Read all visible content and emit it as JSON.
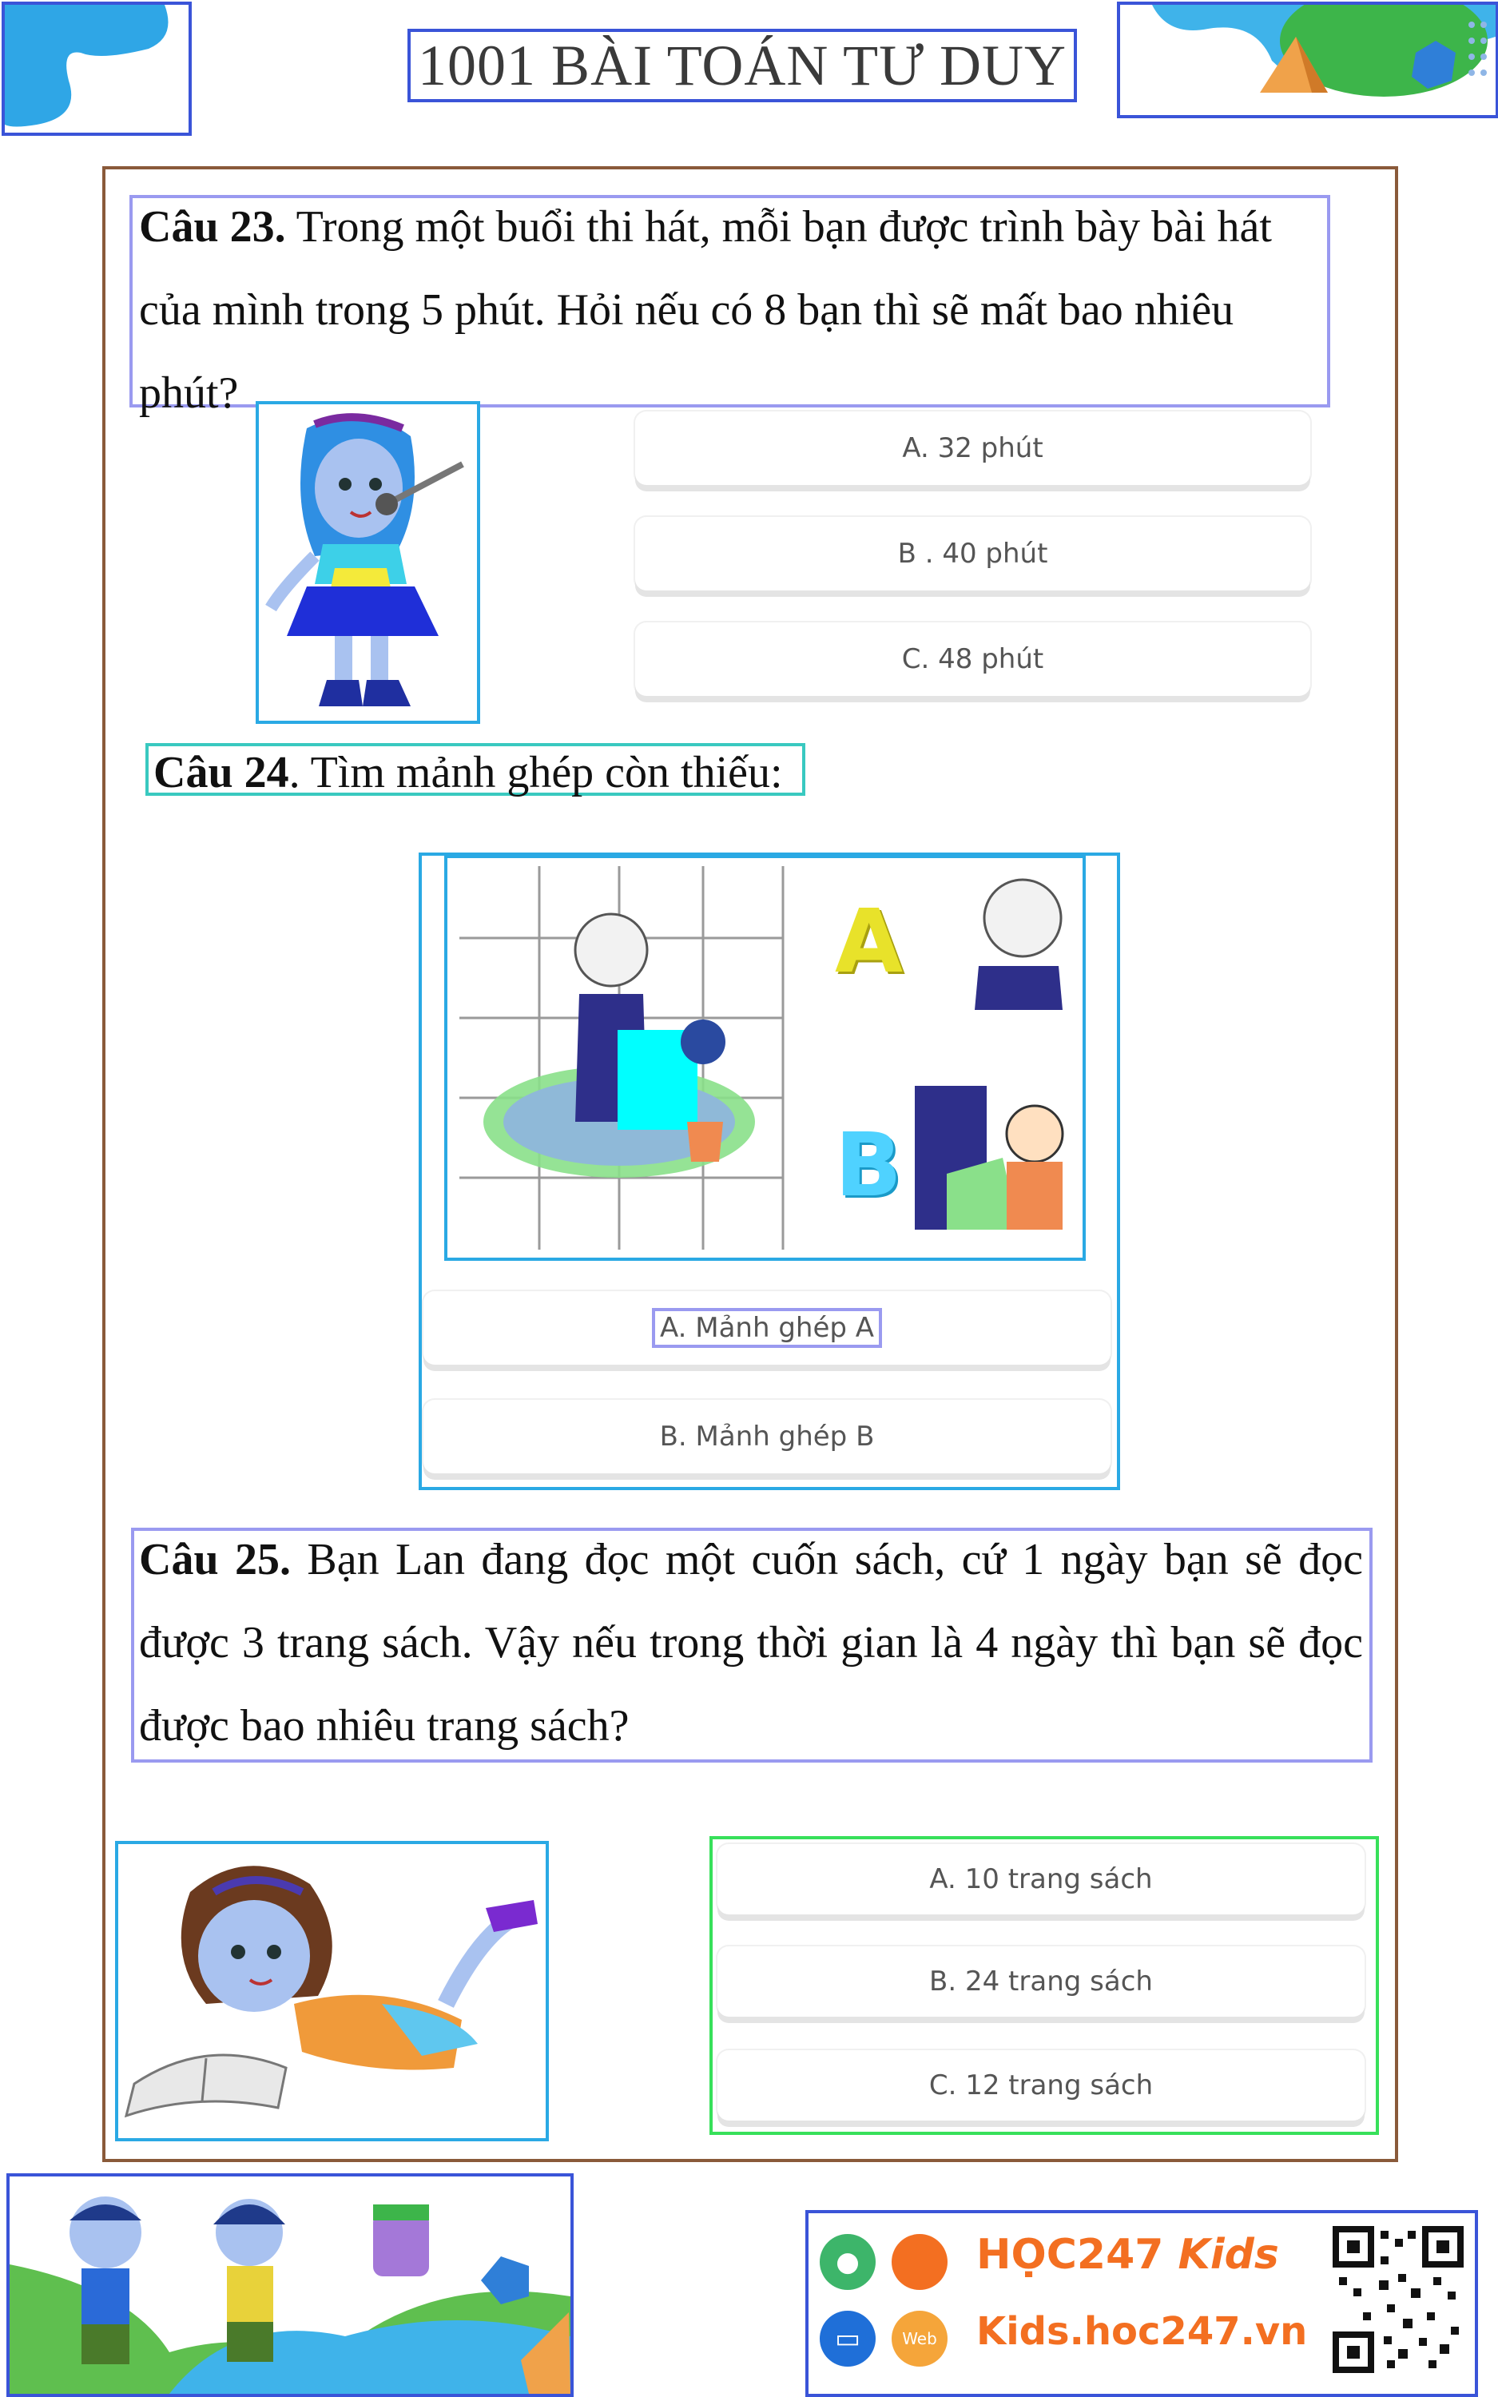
{
  "header": {
    "title": "1001 BÀI TOÁN TƯ DUY"
  },
  "q23": {
    "label": "Câu 23.",
    "text": " Trong một buổi thi hát, mỗi bạn được trình bày bài hát của mình trong 5 phút. Hỏi nếu có 8 bạn thì sẽ mất bao nhiêu phút?",
    "options": [
      "A. 32 phút",
      "B . 40 phút",
      "C. 48 phút"
    ]
  },
  "q24": {
    "label": "Câu 24",
    "text": ". Tìm mảnh ghép còn thiếu:",
    "piece_labels": [
      "A",
      "B"
    ],
    "options": [
      "A. Mảnh ghép A",
      "B. Mảnh ghép B"
    ]
  },
  "q25": {
    "label": "Câu 25.",
    "text": " Bạn Lan đang đọc một cuốn sách, cứ 1 ngày bạn sẽ đọc được 3 trang sách. Vậy nếu trong thời gian là 4 ngày thì bạn sẽ đọc được bao nhiêu trang sách?",
    "options": [
      "A. 10 trang sách",
      "B. 24 trang sách",
      "C. 12 trang sách"
    ]
  },
  "footer": {
    "brand": "HỌC247",
    "brand_kids": "Kids",
    "site": "Kids.hoc247.vn",
    "web_badge": "Web"
  },
  "colors": {
    "brand_orange": "#f36f21",
    "brand_blue": "#1f6fb5"
  }
}
